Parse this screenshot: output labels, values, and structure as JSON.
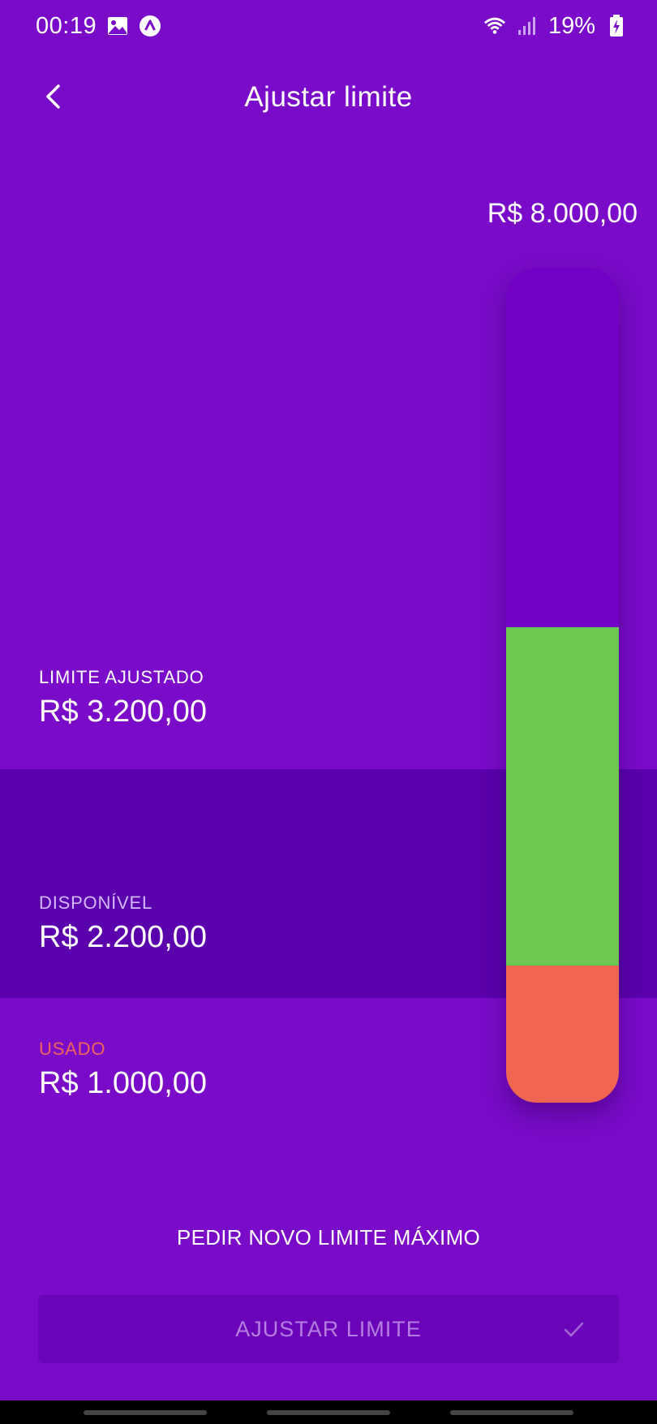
{
  "status_bar": {
    "time": "00:19",
    "battery_percent": "19%",
    "icons": [
      "image-icon",
      "app-a-icon",
      "wifi-icon",
      "signal-icon",
      "battery-charging-icon"
    ]
  },
  "header": {
    "title": "Ajustar limite",
    "back_icon": "chevron-left-icon"
  },
  "limit_bar": {
    "max_label": "R$ 8.000,00",
    "max_value": 8000,
    "adjusted_value": 3200,
    "available_value": 2200,
    "used_value": 1000,
    "colors": {
      "available": "#6cc850",
      "used": "#ef6552",
      "track": "#7200c5"
    }
  },
  "adjusted": {
    "label": "LIMITE AJUSTADO",
    "value": "R$ 3.200,00"
  },
  "available": {
    "label": "DISPONÍVEL",
    "value": "R$ 2.200,00"
  },
  "used": {
    "label": "USADO",
    "value": "R$ 1.000,00"
  },
  "actions": {
    "request_new_max": "PEDIR NOVO LIMITE MÁXIMO",
    "adjust_button": "AJUSTAR LIMITE",
    "adjust_icon": "check-icon"
  },
  "theme": {
    "background": "#7a0bc9",
    "band": "#5a00ad",
    "button_bg": "#6a04b8"
  }
}
